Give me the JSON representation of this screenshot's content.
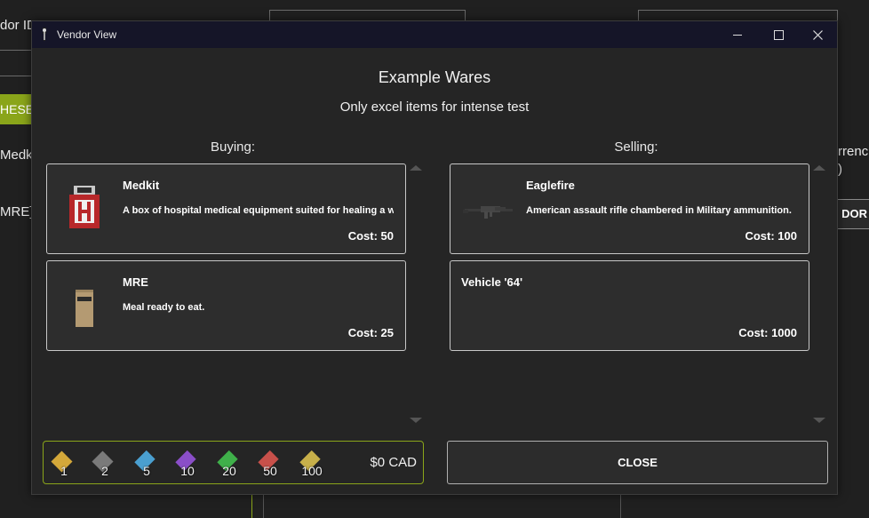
{
  "background": {
    "vendor_id_label": "dor ID",
    "green_button": "HESE",
    "medkit_label": "Medki",
    "mre_label": "MRE]",
    "currency_label": "rrenc",
    "currency_paren": ")",
    "vendor_button": "DOR"
  },
  "window": {
    "title": "Vendor View",
    "minimize_label": "",
    "maximize_label": "",
    "close_label": ""
  },
  "vendor": {
    "name": "Example Wares",
    "description": "Only excel items for intense test"
  },
  "buying": {
    "header": "Buying:",
    "items": [
      {
        "name": "Medkit",
        "description": "A box of hospital medical equipment suited for healing a wide variety of injuries.",
        "cost": "Cost: 50",
        "icon": "medkit-icon"
      },
      {
        "name": "MRE",
        "description": "Meal ready to eat.",
        "cost": "Cost: 25",
        "icon": "mre-icon"
      }
    ]
  },
  "selling": {
    "header": "Selling:",
    "items": [
      {
        "name": "Eaglefire",
        "description": "American assault rifle chambered in Military ammunition.",
        "cost": "Cost: 100",
        "icon": "rifle-icon"
      },
      {
        "name": "Vehicle '64'",
        "description": "",
        "cost": "Cost: 1000",
        "icon": ""
      }
    ]
  },
  "currency": {
    "denominations": [
      {
        "value": "1",
        "color": "#d4a83a"
      },
      {
        "value": "2",
        "color": "#8a8a8a"
      },
      {
        "value": "5",
        "color": "#4a9fd0"
      },
      {
        "value": "10",
        "color": "#8a4ec8"
      },
      {
        "value": "20",
        "color": "#3fb04a"
      },
      {
        "value": "50",
        "color": "#c8504a"
      },
      {
        "value": "100",
        "color": "#c8b04a"
      }
    ],
    "balance": "$0 CAD"
  },
  "close_button": "CLOSE",
  "colors": {
    "accent": "#8aa51a",
    "titlebar": "#151528",
    "card_border": "#c8c8c8"
  }
}
